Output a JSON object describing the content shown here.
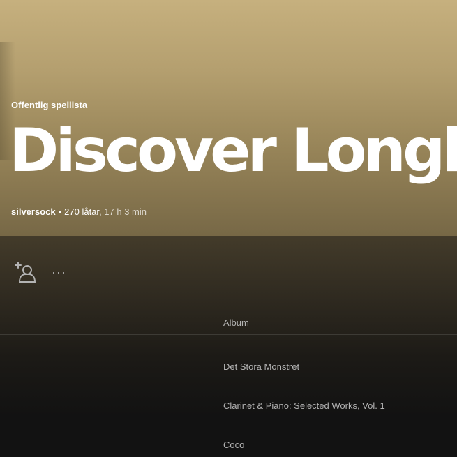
{
  "header": {
    "playlist_type": "Offentlig spellista",
    "title": "Discover Longly",
    "owner": "silversock",
    "separator": "•",
    "track_count": "270 låtar,",
    "duration": "17 h 3 min"
  },
  "actions": {
    "follow_icon": "add-user-icon",
    "more_label": "···"
  },
  "table": {
    "column_album": "Album",
    "rows": [
      {
        "album": "Det Stora Monstret"
      },
      {
        "album": "Clarinet & Piano: Selected Works, Vol. 1"
      },
      {
        "album": "Coco"
      }
    ]
  },
  "colors": {
    "hero_top": "#c6b07e",
    "hero_bottom": "#776846",
    "background": "#121212",
    "text_primary": "#ffffff",
    "text_secondary": "#b3b3b3"
  }
}
